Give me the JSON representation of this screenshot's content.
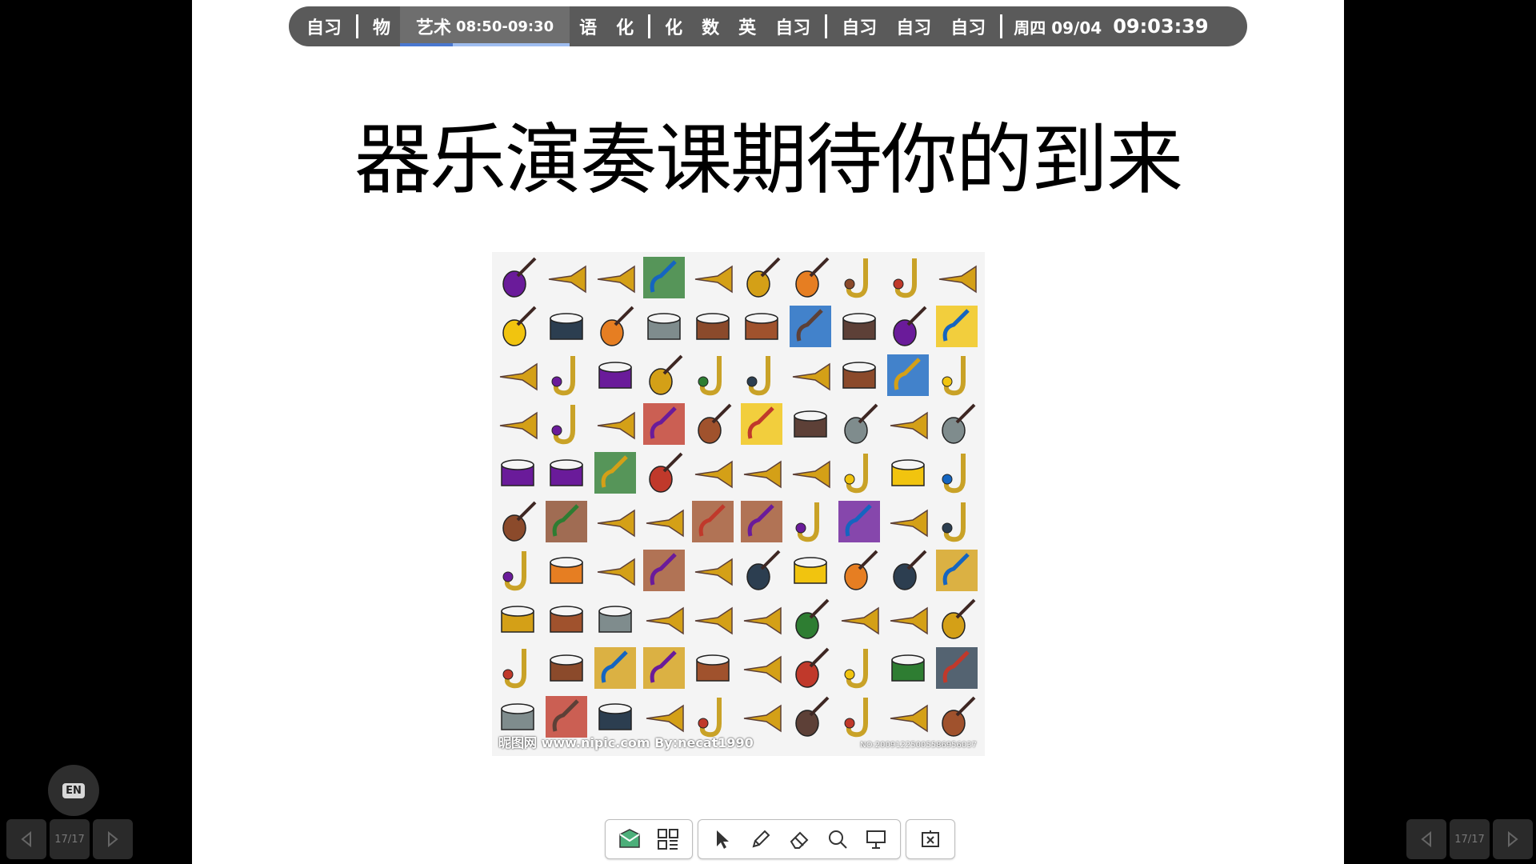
{
  "schedule": {
    "items_a": [
      "自习"
    ],
    "items_b": [
      "物"
    ],
    "active": {
      "subject": "艺术",
      "time": "08:50-09:30"
    },
    "items_c": [
      "语",
      "化"
    ],
    "items_d": [
      "化",
      "数",
      "英",
      "自习"
    ],
    "items_e": [
      "自习",
      "自习",
      "自习"
    ],
    "date": "周四 09/04",
    "clock": "09:03:39"
  },
  "slide": {
    "title": "器乐演奏课期待你的到来",
    "image_watermark": "昵图网 www.nipic.com    By:necat1990",
    "image_id": "NO:20091225005586956037"
  },
  "toolbar": {
    "icons": [
      "chat-icon",
      "qr-icon",
      "pointer-icon",
      "pen-icon",
      "eraser-icon",
      "search-icon",
      "whiteboard-icon",
      "exit-slideshow-icon"
    ]
  },
  "nav": {
    "page_left": "17/17",
    "page_right": "17/17"
  },
  "lang": {
    "label": "EN"
  },
  "colors": {
    "slide_bg": "#ffffff",
    "bar_bg": "#5a5a5a",
    "accent": "#4a78d0"
  }
}
